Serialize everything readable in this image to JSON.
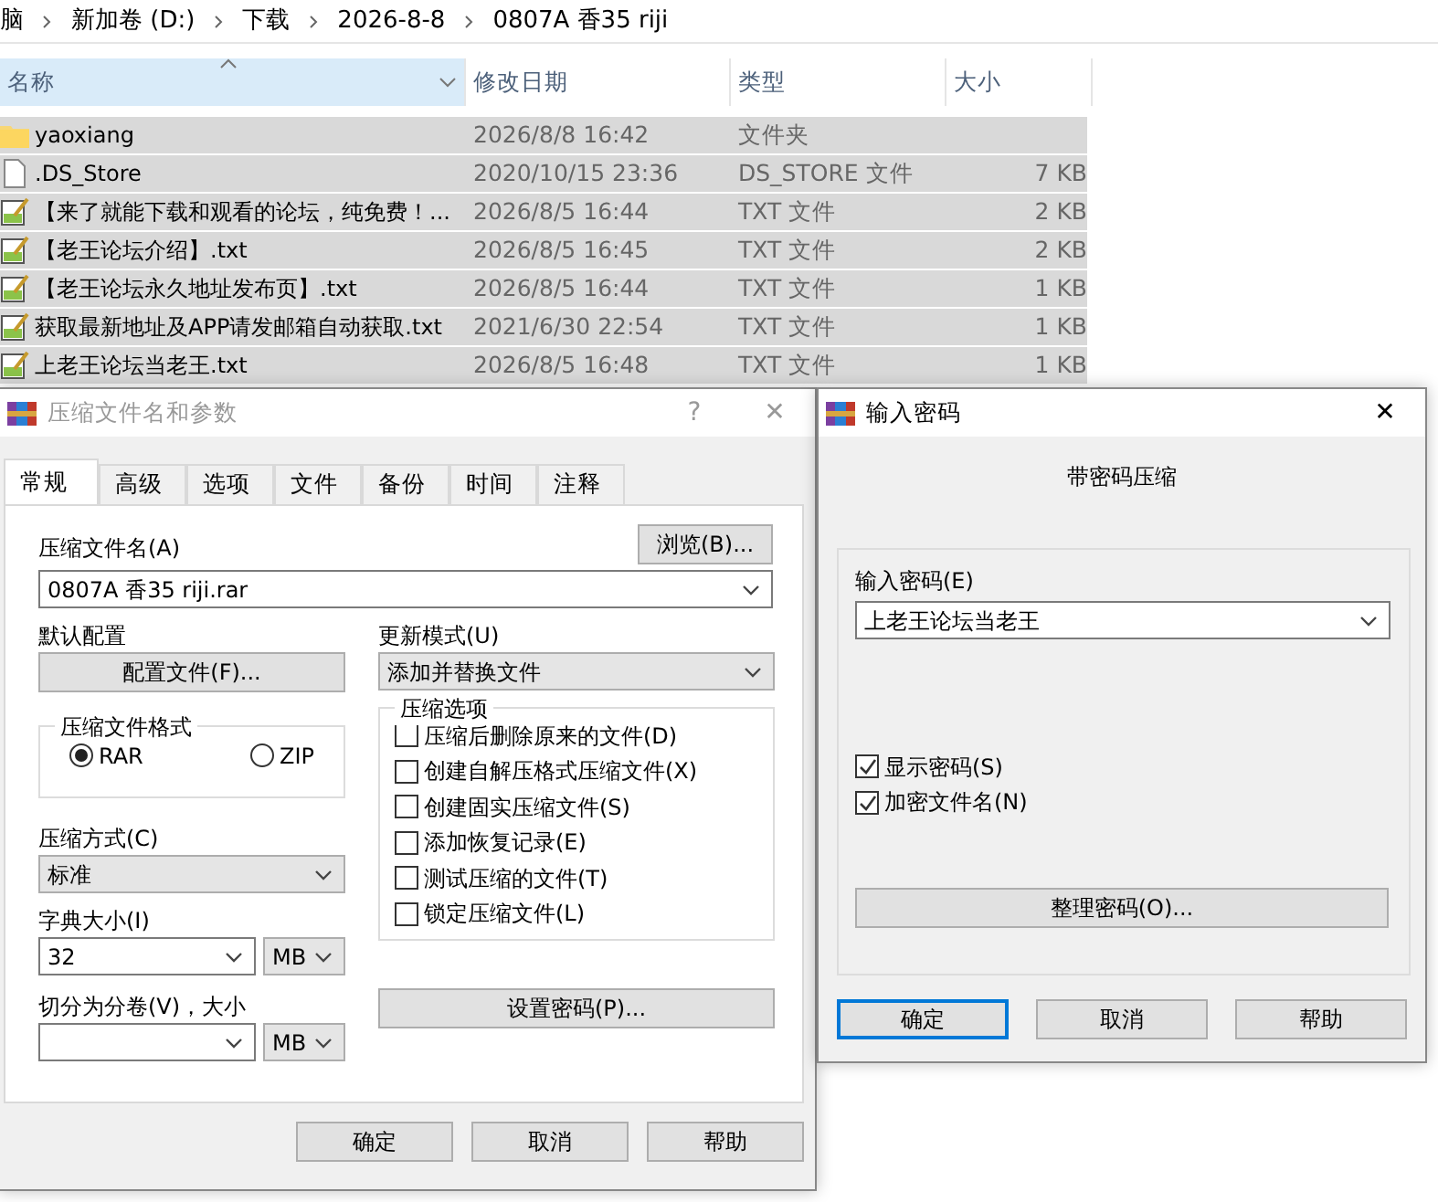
{
  "explorer": {
    "breadcrumb": [
      "脑",
      "新加卷 (D:)",
      "下载",
      "2026-8-8",
      "0807A 香35 riji"
    ],
    "columns": [
      {
        "label": "名称",
        "sorted": true
      },
      {
        "label": "修改日期",
        "sorted": false
      },
      {
        "label": "类型",
        "sorted": false
      },
      {
        "label": "大小",
        "sorted": false
      }
    ],
    "files": [
      {
        "kind": "folder",
        "name": "yaoxiang",
        "date": "2026/8/8 16:42",
        "type": "文件夹",
        "selected": true
      },
      {
        "kind": "file",
        "name": ".DS_Store",
        "date": "2020/10/15 23:36",
        "type": "DS_STORE 文件",
        "size": "7 KB",
        "selected": true
      },
      {
        "kind": "txt",
        "name": "【来了就能下载和观看的论坛，纯免费！...",
        "date": "2026/8/5 16:44",
        "type": "TXT 文件",
        "size": "2 KB",
        "selected": true
      },
      {
        "kind": "txt",
        "name": "【老王论坛介绍】.txt",
        "date": "2026/8/5 16:45",
        "type": "TXT 文件",
        "size": "2 KB",
        "selected": true
      },
      {
        "kind": "txt",
        "name": "【老王论坛永久地址发布页】.txt",
        "date": "2026/8/5 16:44",
        "type": "TXT 文件",
        "size": "1 KB",
        "selected": true
      },
      {
        "kind": "txt",
        "name": "获取最新地址及APP请发邮箱自动获取.txt",
        "date": "2021/6/30 22:54",
        "type": "TXT 文件",
        "size": "1 KB",
        "selected": true
      },
      {
        "kind": "txt",
        "name": "上老王论坛当老王.txt",
        "date": "2026/8/5 16:48",
        "type": "TXT 文件",
        "size": "1 KB",
        "selected": true
      }
    ]
  },
  "archive_dialog": {
    "title": "压缩文件名和参数",
    "help": "?",
    "close": "✕",
    "tabs": [
      {
        "label": "常规",
        "selected": true
      },
      {
        "label": "高级",
        "selected": false
      },
      {
        "label": "选项",
        "selected": false
      },
      {
        "label": "文件",
        "selected": false
      },
      {
        "label": "备份",
        "selected": false
      },
      {
        "label": "时间",
        "selected": false
      },
      {
        "label": "注释",
        "selected": false
      }
    ],
    "archive_name_label": "压缩文件名(A)",
    "browse_button": "浏览(B)...",
    "archive_name": "0807A 香35 riji.rar",
    "profile_label": "默认配置",
    "profile_button": "配置文件(F)...",
    "update_mode_label": "更新模式(U)",
    "update_mode": "添加并替换文件",
    "format_group": {
      "title": "压缩文件格式",
      "options": [
        {
          "label": "RAR",
          "selected": true
        },
        {
          "label": "ZIP",
          "selected": false
        }
      ]
    },
    "options_group": {
      "title": "压缩选项",
      "items": [
        {
          "label": "压缩后删除原来的文件(D)",
          "checked": false
        },
        {
          "label": "创建自解压格式压缩文件(X)",
          "checked": false
        },
        {
          "label": "创建固实压缩文件(S)",
          "checked": false
        },
        {
          "label": "添加恢复记录(E)",
          "checked": false
        },
        {
          "label": "测试压缩的文件(T)",
          "checked": false
        },
        {
          "label": "锁定压缩文件(L)",
          "checked": false
        }
      ]
    },
    "method_label": "压缩方式(C)",
    "method": "标准",
    "dict_label": "字典大小(I)",
    "dict_size": "32",
    "dict_unit": "MB",
    "split_label": "切分为分卷(V)，大小",
    "split_unit": "MB",
    "password_button": "设置密码(P)...",
    "buttons": [
      {
        "label": "确定",
        "focused": false
      },
      {
        "label": "取消",
        "focused": false
      },
      {
        "label": "帮助",
        "focused": false
      }
    ]
  },
  "password_dialog": {
    "title": "输入密码",
    "close": "✕",
    "heading": "带密码压缩",
    "password_label": "输入密码(E)",
    "password": "上老王论坛当老王",
    "checks": [
      {
        "label": "显示密码(S)",
        "checked": true
      },
      {
        "label": "加密文件名(N)",
        "checked": true
      }
    ],
    "organize_button": "整理密码(O)...",
    "buttons": [
      {
        "label": "确定",
        "focused": true
      },
      {
        "label": "取消",
        "focused": false
      },
      {
        "label": "帮助",
        "focused": false
      }
    ]
  }
}
